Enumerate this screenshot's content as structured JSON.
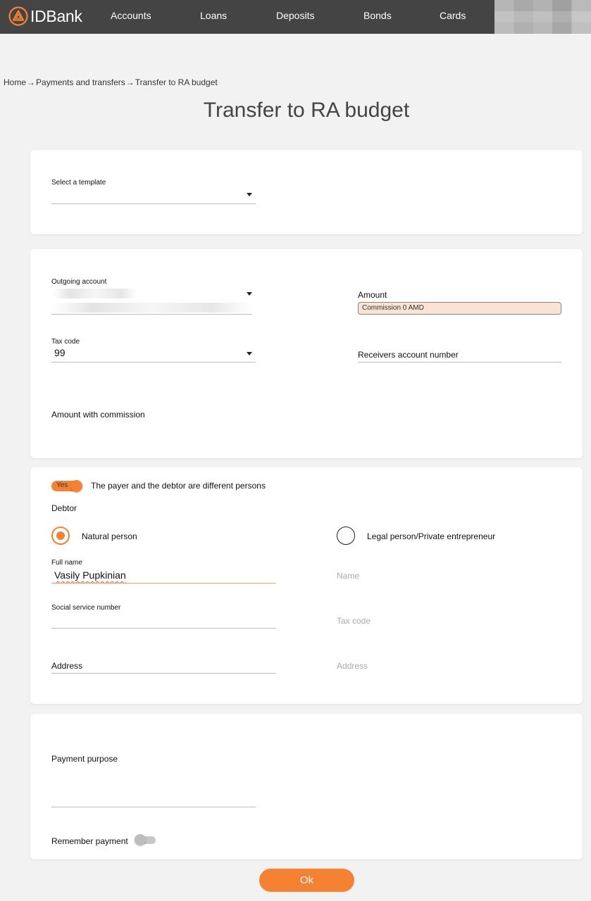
{
  "header": {
    "logo_text": "IDBank",
    "nav": [
      "Accounts",
      "Loans",
      "Deposits",
      "Bonds",
      "Cards"
    ]
  },
  "breadcrumb": [
    "Home",
    "Payments and transfers",
    "Transfer to RA budget"
  ],
  "breadcrumb_separator": "→",
  "page_title": "Transfer to RA budget",
  "template": {
    "label": "Select a template",
    "value": ""
  },
  "account": {
    "outgoing_label": "Outgoing account",
    "amount_label": "Amount",
    "commission_text": "Commission 0 AMD",
    "tax_code_label": "Tax code",
    "tax_code_value": "99",
    "receivers_label": "Receivers account number",
    "amount_with_commission_label": "Amount with commission"
  },
  "debtor": {
    "toggle_text": "Yes",
    "toggle_on": true,
    "different_persons_label": "The payer and the debtor are different persons",
    "section_label": "Debtor",
    "natural_person_label": "Natural person",
    "legal_person_label": "Legal person/Private entrepreneur",
    "selected_type": "natural",
    "full_name_label": "Full name",
    "full_name_value": "Vasily Pupkinian",
    "social_service_label": "Social service number",
    "address_label": "Address",
    "legal_name_placeholder": "Name",
    "legal_tax_code_placeholder": "Tax code",
    "legal_address_placeholder": "Address"
  },
  "payment": {
    "purpose_label": "Payment purpose",
    "remember_label": "Remember payment",
    "remember_on": false
  },
  "ok_label": "Ok",
  "colors": {
    "accent": "#f58233",
    "header_bg": "#444444",
    "commission_bg": "#fbe3d4"
  }
}
